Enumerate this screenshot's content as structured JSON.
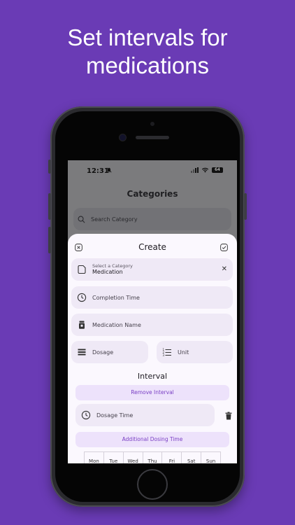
{
  "headline": {
    "line1": "Set intervals for",
    "line2": "medications"
  },
  "status_bar": {
    "time": "12:31",
    "battery": "64"
  },
  "categories_screen": {
    "title": "Categories",
    "search_placeholder": "Search Category"
  },
  "create_sheet": {
    "title": "Create",
    "category": {
      "label": "Select a Category",
      "value": "Medication"
    },
    "completion_time_label": "Completion Time",
    "medication_name_label": "Medication Name",
    "dosage_label": "Dosage",
    "unit_label": "Unit",
    "interval_title": "Interval",
    "remove_interval_label": "Remove Interval",
    "dosage_time_label": "Dosage Time",
    "additional_dosing_label": "Additional Dosing Time",
    "days": [
      "Mon",
      "Tue",
      "Wed",
      "Thu",
      "Fri",
      "Sat",
      "Sun"
    ]
  },
  "colors": {
    "background": "#6a3bb5",
    "accent": "#7a3fc4",
    "field": "#efe9f6",
    "pill": "#ede2fb"
  }
}
